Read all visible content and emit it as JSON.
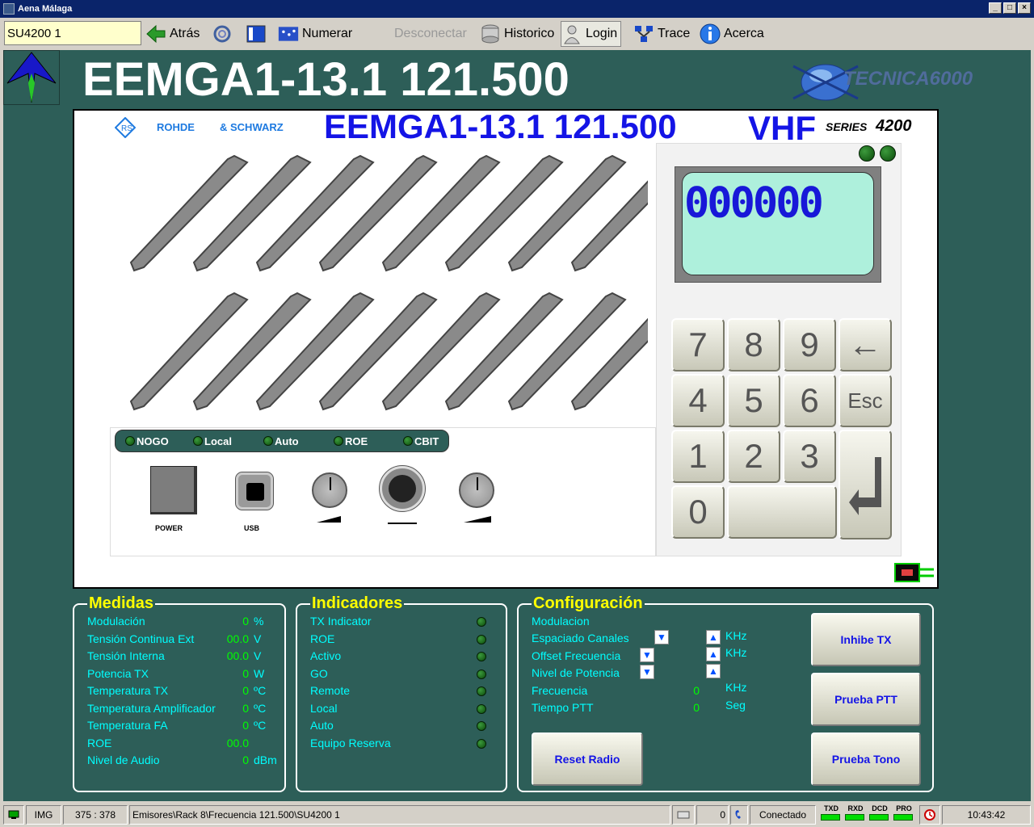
{
  "window": {
    "title": "Aena Málaga"
  },
  "toolbar": {
    "unit_selected": "SU4200 1",
    "back_label": "Atrás",
    "number_label": "Numerar",
    "disconnect_label": "Desconectar",
    "history_label": "Historico",
    "login_label": "Login",
    "trace_label": "Trace",
    "about_label": "Acerca"
  },
  "header": {
    "title": "EEMGA1-13.1 121.500",
    "brand_logo_text": "TECNICA6000"
  },
  "panel": {
    "rs_brand_1": "ROHDE",
    "rs_brand_2": "& SCHWARZ",
    "title": "EEMGA1-13.1 121.500",
    "band": "VHF",
    "series_label": "SERIES",
    "series_number": "4200",
    "lcd_text": "000000",
    "keypad": [
      "7",
      "8",
      "9",
      "←",
      "4",
      "5",
      "6",
      "Esc",
      "1",
      "2",
      "3",
      "0"
    ],
    "status_leds": [
      "NOGO",
      "Local",
      "Auto",
      "ROE",
      "CBIT"
    ],
    "power_label": "POWER",
    "usb_label": "USB"
  },
  "medidas": {
    "title": "Medidas",
    "rows": [
      {
        "label": "Modulación",
        "value": "0",
        "unit": "%"
      },
      {
        "label": "Tensión Continua Ext",
        "value": "00.0",
        "unit": "V"
      },
      {
        "label": "Tensión Interna",
        "value": "00.0",
        "unit": "V"
      },
      {
        "label": "Potencia TX",
        "value": "0",
        "unit": "W"
      },
      {
        "label": "Temperatura TX",
        "value": "0",
        "unit": "ºC"
      },
      {
        "label": "Temperatura Amplificador",
        "value": "0",
        "unit": "ºC"
      },
      {
        "label": "Temperatura FA",
        "value": "0",
        "unit": "ºC"
      },
      {
        "label": "ROE",
        "value": "00.0",
        "unit": ""
      },
      {
        "label": "Nivel de Audio",
        "value": "0",
        "unit": "dBm"
      }
    ]
  },
  "indicadores": {
    "title": "Indicadores",
    "rows": [
      "TX Indicator",
      "ROE",
      "Activo",
      "GO",
      "Remote",
      "Local",
      "Auto",
      "Equipo Reserva"
    ]
  },
  "configuracion": {
    "title": "Configuración",
    "modulacion": "Modulacion",
    "espaciado": "Espaciado Canales",
    "offset": "Offset Frecuencia",
    "potencia": "Nivel de Potencia",
    "frecuencia": "Frecuencia",
    "frecuencia_value": "0",
    "tiempo": "Tiempo PTT",
    "tiempo_value": "0",
    "unit_khz": "KHz",
    "unit_seg": "Seg",
    "btn_inhibe": "Inhibe TX",
    "btn_ptt": "Prueba PTT",
    "btn_reset": "Reset Radio",
    "btn_tono": "Prueba Tono"
  },
  "statusbar": {
    "img": "IMG",
    "coords": "375 : 378",
    "path": "Emisores\\Rack 8\\Frecuencia 121.500\\SU4200 1",
    "count": "0",
    "state": "Conectado",
    "ind_txd": "TXD",
    "ind_rxd": "RXD",
    "ind_dcd": "DCD",
    "ind_pro": "PRO",
    "time": "10:43:42"
  },
  "colors": {
    "background": "#2d5e58",
    "label": "#00ffff",
    "value": "#00ff00",
    "title": "#ffff00",
    "panel_title": "#1414e6"
  }
}
